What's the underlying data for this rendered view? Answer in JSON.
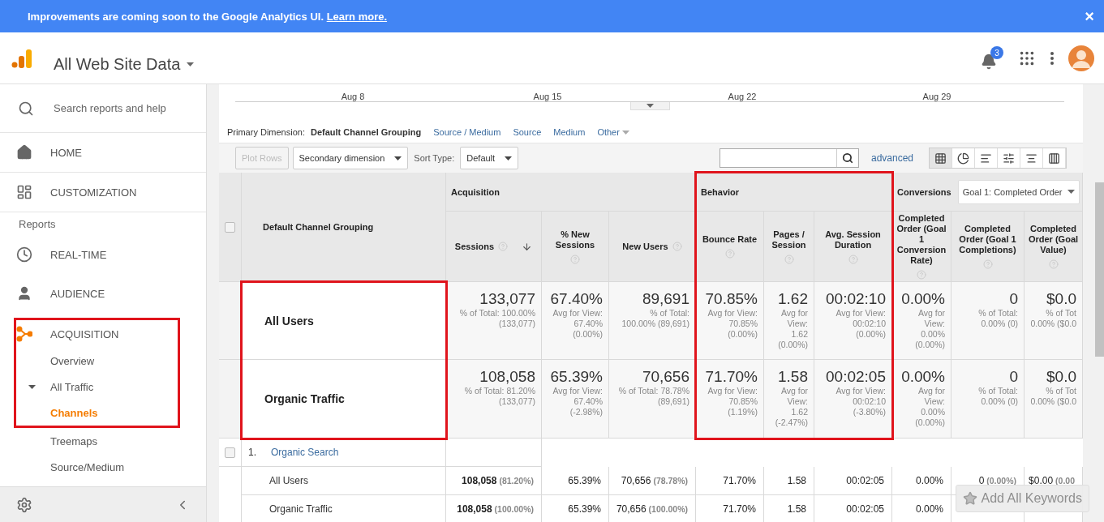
{
  "banner": {
    "text": "Improvements are coming soon to the Google Analytics UI.",
    "link": "Learn more.",
    "close": "×"
  },
  "header": {
    "title": "All Web Site Data",
    "notifications": "3"
  },
  "sidebar": {
    "search_placeholder": "Search reports and help",
    "items": [
      {
        "kind": "nav",
        "label": "HOME",
        "active": false,
        "highlighted": false
      },
      {
        "kind": "nav",
        "label": "CUSTOMIZATION",
        "active": false,
        "highlighted": false
      },
      {
        "kind": "section",
        "label": "Reports"
      },
      {
        "kind": "nav",
        "label": "REAL-TIME",
        "active": false,
        "highlighted": false
      },
      {
        "kind": "nav",
        "label": "AUDIENCE",
        "active": false,
        "highlighted": false
      },
      {
        "kind": "nav",
        "label": "ACQUISITION",
        "active": true,
        "highlighted": true,
        "expanded": true,
        "children": [
          {
            "label": "Overview",
            "selected": false,
            "highlighted": true
          },
          {
            "label": "All Traffic",
            "selected": false,
            "highlighted": true,
            "expanded": true,
            "children": [
              {
                "label": "Channels",
                "selected": true,
                "highlighted": true
              },
              {
                "label": "Treemaps",
                "selected": false,
                "highlighted": false
              },
              {
                "label": "Source/Medium",
                "selected": false,
                "highlighted": false
              }
            ]
          }
        ]
      }
    ]
  },
  "chart_axis": {
    "labels": [
      "Aug 8",
      "Aug 15",
      "Aug 22",
      "Aug 29"
    ]
  },
  "primary_dimension": {
    "label": "Primary Dimension:",
    "options": [
      {
        "label": "Default Channel Grouping",
        "selected": true,
        "kind": "link"
      },
      {
        "label": "Source / Medium",
        "selected": false,
        "kind": "link"
      },
      {
        "label": "Source",
        "selected": false,
        "kind": "link"
      },
      {
        "label": "Medium",
        "selected": false,
        "kind": "link"
      },
      {
        "label": "Other",
        "selected": false,
        "kind": "menu"
      }
    ]
  },
  "toolbar": {
    "plot_rows": {
      "label": "Plot Rows",
      "disabled": true
    },
    "secondary": "Secondary dimension",
    "sort_label": "Sort Type:",
    "sort_value": "Default",
    "advanced": "advanced",
    "views": [
      {
        "selected": true
      },
      {
        "selected": false
      },
      {
        "selected": false
      },
      {
        "selected": false
      },
      {
        "selected": false
      },
      {
        "selected": false
      }
    ]
  },
  "table": {
    "dimension": "Default Channel Grouping",
    "header_checked": false,
    "column_groups": [
      {
        "label": "Acquisition",
        "highlighted": false,
        "columns": [
          {
            "label": "Sessions",
            "sorted": true
          },
          {
            "label": "% New Sessions",
            "sorted": false
          },
          {
            "label": "New Users",
            "sorted": false
          }
        ]
      },
      {
        "label": "Behavior",
        "highlighted": true,
        "columns": [
          {
            "label": "Bounce Rate",
            "sorted": false
          },
          {
            "label": "Pages / Session",
            "sorted": false
          },
          {
            "label": "Avg. Session Duration",
            "sorted": false
          }
        ]
      },
      {
        "label": "Conversions",
        "highlighted": false,
        "selector": "Goal 1: Completed Order",
        "columns": [
          {
            "label": "Completed Order (Goal 1 Conversion Rate)",
            "sorted": false
          },
          {
            "label": "Completed Order (Goal 1 Completions)",
            "sorted": false
          },
          {
            "label": "Completed Order (Goal Value)",
            "sorted": false
          }
        ]
      }
    ],
    "summary_rows": [
      {
        "label": "All Users",
        "highlighted": true,
        "cells": [
          {
            "value": "133,077",
            "note": [
              "% of Total: 100.00%",
              "(133,077)"
            ]
          },
          {
            "value": "67.40%",
            "note": [
              "Avg for View:",
              "67.40%",
              "(0.00%)"
            ]
          },
          {
            "value": "89,691",
            "note": [
              "% of Total:",
              "100.00% (89,691)"
            ]
          },
          {
            "value": "70.85%",
            "note": [
              "Avg for View:",
              "70.85%",
              "(0.00%)"
            ]
          },
          {
            "value": "1.62",
            "note": [
              "Avg for",
              "View:",
              "1.62",
              "(0.00%)"
            ]
          },
          {
            "value": "00:02:10",
            "note": [
              "Avg for View:",
              "00:02:10",
              "(0.00%)"
            ]
          },
          {
            "value": "0.00%",
            "note": [
              "Avg for",
              "View:",
              "0.00%",
              "(0.00%)"
            ]
          },
          {
            "value": "0",
            "note": [
              "% of Total:",
              "0.00% (0)"
            ]
          },
          {
            "value": "$0.0",
            "note": [
              "% of Tot",
              "0.00% ($0.0"
            ]
          }
        ]
      },
      {
        "label": "Organic Traffic",
        "highlighted": true,
        "cells": [
          {
            "value": "108,058",
            "note": [
              "% of Total: 81.20%",
              "(133,077)"
            ]
          },
          {
            "value": "65.39%",
            "note": [
              "Avg for View:",
              "67.40%",
              "(-2.98%)"
            ]
          },
          {
            "value": "70,656",
            "note": [
              "% of Total: 78.78%",
              "(89,691)"
            ]
          },
          {
            "value": "71.70%",
            "note": [
              "Avg for View:",
              "70.85%",
              "(1.19%)"
            ]
          },
          {
            "value": "1.58",
            "note": [
              "Avg for",
              "View:",
              "1.62",
              "(-2.47%)"
            ]
          },
          {
            "value": "00:02:05",
            "note": [
              "Avg for View:",
              "00:02:10",
              "(-3.80%)"
            ]
          },
          {
            "value": "0.00%",
            "note": [
              "Avg for",
              "View:",
              "0.00%",
              "(0.00%)"
            ]
          },
          {
            "value": "0",
            "note": [
              "% of Total:",
              "0.00% (0)"
            ]
          },
          {
            "value": "$0.0",
            "note": [
              "% of Tot",
              "0.00% ($0.0"
            ]
          }
        ]
      }
    ],
    "groups": [
      {
        "index": "1.",
        "label": "Organic Search",
        "checked": false,
        "segments": [
          {
            "label": "All Users",
            "cells": [
              {
                "value": "108,058",
                "share": "(81.20%)"
              },
              {
                "value": "65.39%"
              },
              {
                "value": "70,656",
                "share": "(78.78%)"
              },
              {
                "value": "71.70%"
              },
              {
                "value": "1.58"
              },
              {
                "value": "00:02:05"
              },
              {
                "value": "0.00%"
              },
              {
                "value": "0",
                "share": "(0.00%)"
              },
              {
                "value": "$0.00",
                "share": "(0.00"
              }
            ]
          },
          {
            "label": "Organic Traffic",
            "cells": [
              {
                "value": "108,058",
                "share": "(100.00%)"
              },
              {
                "value": "65.39%"
              },
              {
                "value": "70,656",
                "share": "(100.00%)"
              },
              {
                "value": "71.70%"
              },
              {
                "value": "1.58"
              },
              {
                "value": "00:02:05"
              },
              {
                "value": "0.00%"
              },
              null,
              null
            ]
          }
        ]
      }
    ]
  },
  "floating_button": "Add All Keywords"
}
